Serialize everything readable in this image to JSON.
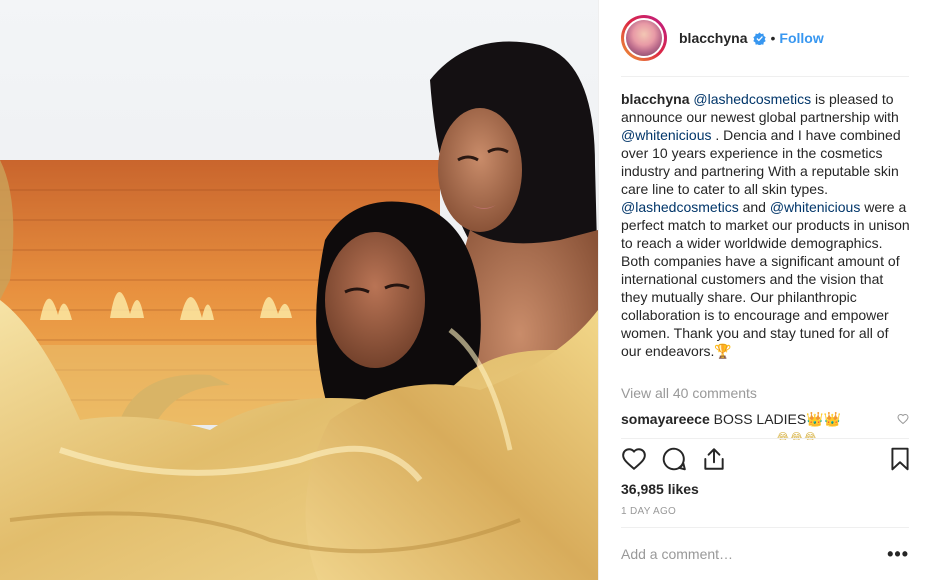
{
  "post": {
    "username": "blacchyna",
    "follow_label": "Follow",
    "dot": "•",
    "caption": {
      "p1": " is pleased to announce our newest global partnership with ",
      "p2": " . Dencia and I have combined over 10 years experience in the cosmetics industry and partnering With a reputable skin care line to cater to all skin types. ",
      "p3": " and ",
      "p4": " were a perfect match to market our products in unison to reach a wider worldwide demographics. Both companies have a significant amount of international customers and the vision that they mutually share. Our philanthropic collaboration is to encourage and empower women. Thank you and stay tuned for all of our endeavors.",
      "mention_lashed": "@lashedcosmetics",
      "mention_white": "@whitenicious",
      "trophy": "🏆"
    },
    "view_all_comments": "View all 40 comments",
    "comments": [
      {
        "username": "somayareece",
        "text": "BOSS LADIES👑👑"
      }
    ],
    "next_comment_peek": "😂😂😂",
    "likes": "36,985 likes",
    "time_ago": "1 DAY AGO",
    "add_comment_placeholder": "Add a comment…",
    "more_label": "•••"
  },
  "icons": {
    "verified": "verified-badge-icon",
    "like": "heart-icon",
    "comment": "comment-bubble-icon",
    "share": "share-icon",
    "save": "bookmark-icon",
    "comment_like": "small-heart-icon"
  },
  "colors": {
    "follow": "#3897f0",
    "mention": "#003569",
    "muted": "#999999",
    "text": "#262626"
  }
}
